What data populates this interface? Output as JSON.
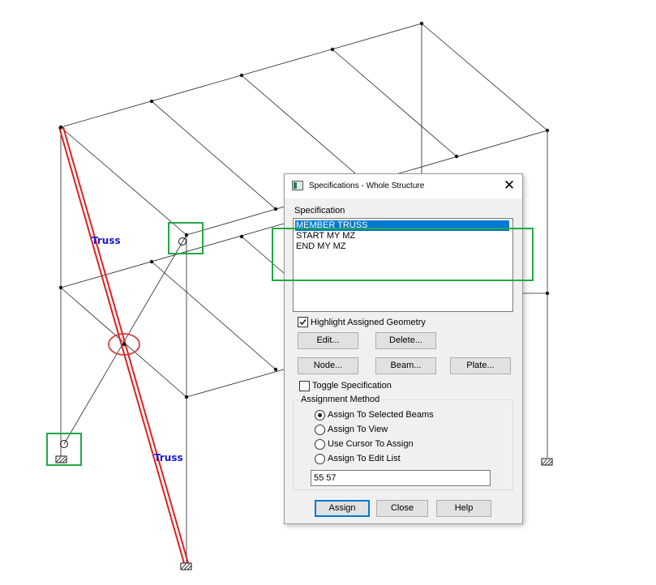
{
  "canvas": {
    "truss_labels": [
      "Truss",
      "Truss"
    ]
  },
  "dialog": {
    "title": "Specifications - Whole Structure",
    "specification_label": "Specification",
    "specifications": [
      {
        "text": "MEMBER TRUSS",
        "selected": true
      },
      {
        "text": "START MY MZ",
        "selected": false
      },
      {
        "text": "END MY MZ",
        "selected": false
      }
    ],
    "highlight_label": "Highlight Assigned Geometry",
    "highlight_checked": true,
    "buttons": {
      "edit": "Edit...",
      "delete": "Delete...",
      "node": "Node...",
      "beam": "Beam...",
      "plate": "Plate..."
    },
    "toggle_label": "Toggle Specification",
    "toggle_checked": false,
    "assignment_method": {
      "title": "Assignment Method",
      "options": [
        {
          "label": "Assign To Selected Beams",
          "selected": true
        },
        {
          "label": "Assign To View",
          "selected": false
        },
        {
          "label": "Use Cursor To Assign",
          "selected": false
        },
        {
          "label": "Assign To Edit List",
          "selected": false
        }
      ],
      "edit_list_value": "55 57"
    },
    "footer": {
      "assign": "Assign",
      "close": "Close",
      "help": "Help"
    }
  },
  "colors": {
    "truss_member": "#e02020",
    "truss_label": "#1a1acc",
    "highlight_box": "#22a843",
    "selection": "#0078d7"
  }
}
